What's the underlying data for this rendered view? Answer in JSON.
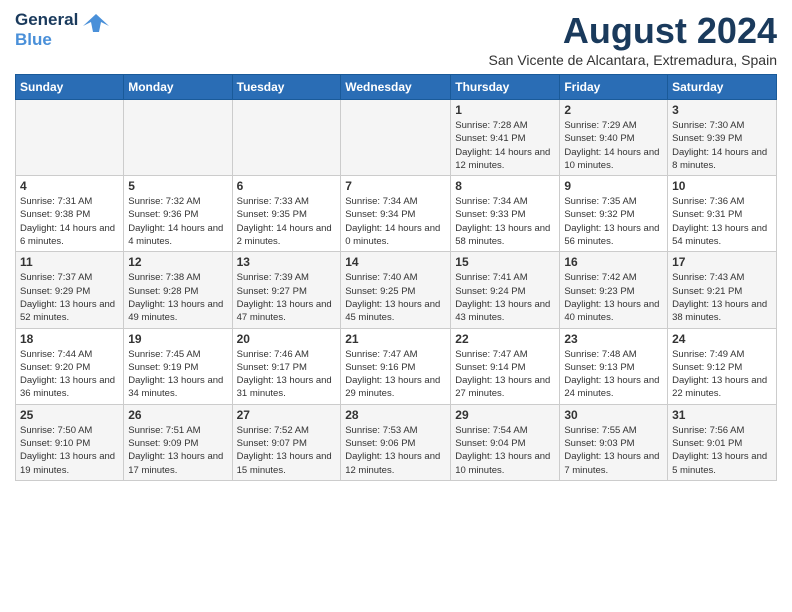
{
  "header": {
    "logo_line1": "General",
    "logo_line2": "Blue",
    "month_title": "August 2024",
    "subtitle": "San Vicente de Alcantara, Extremadura, Spain"
  },
  "days_of_week": [
    "Sunday",
    "Monday",
    "Tuesday",
    "Wednesday",
    "Thursday",
    "Friday",
    "Saturday"
  ],
  "weeks": [
    [
      {
        "day": "",
        "info": ""
      },
      {
        "day": "",
        "info": ""
      },
      {
        "day": "",
        "info": ""
      },
      {
        "day": "",
        "info": ""
      },
      {
        "day": "1",
        "info": "Sunrise: 7:28 AM\nSunset: 9:41 PM\nDaylight: 14 hours and 12 minutes."
      },
      {
        "day": "2",
        "info": "Sunrise: 7:29 AM\nSunset: 9:40 PM\nDaylight: 14 hours and 10 minutes."
      },
      {
        "day": "3",
        "info": "Sunrise: 7:30 AM\nSunset: 9:39 PM\nDaylight: 14 hours and 8 minutes."
      }
    ],
    [
      {
        "day": "4",
        "info": "Sunrise: 7:31 AM\nSunset: 9:38 PM\nDaylight: 14 hours and 6 minutes."
      },
      {
        "day": "5",
        "info": "Sunrise: 7:32 AM\nSunset: 9:36 PM\nDaylight: 14 hours and 4 minutes."
      },
      {
        "day": "6",
        "info": "Sunrise: 7:33 AM\nSunset: 9:35 PM\nDaylight: 14 hours and 2 minutes."
      },
      {
        "day": "7",
        "info": "Sunrise: 7:34 AM\nSunset: 9:34 PM\nDaylight: 14 hours and 0 minutes."
      },
      {
        "day": "8",
        "info": "Sunrise: 7:34 AM\nSunset: 9:33 PM\nDaylight: 13 hours and 58 minutes."
      },
      {
        "day": "9",
        "info": "Sunrise: 7:35 AM\nSunset: 9:32 PM\nDaylight: 13 hours and 56 minutes."
      },
      {
        "day": "10",
        "info": "Sunrise: 7:36 AM\nSunset: 9:31 PM\nDaylight: 13 hours and 54 minutes."
      }
    ],
    [
      {
        "day": "11",
        "info": "Sunrise: 7:37 AM\nSunset: 9:29 PM\nDaylight: 13 hours and 52 minutes."
      },
      {
        "day": "12",
        "info": "Sunrise: 7:38 AM\nSunset: 9:28 PM\nDaylight: 13 hours and 49 minutes."
      },
      {
        "day": "13",
        "info": "Sunrise: 7:39 AM\nSunset: 9:27 PM\nDaylight: 13 hours and 47 minutes."
      },
      {
        "day": "14",
        "info": "Sunrise: 7:40 AM\nSunset: 9:25 PM\nDaylight: 13 hours and 45 minutes."
      },
      {
        "day": "15",
        "info": "Sunrise: 7:41 AM\nSunset: 9:24 PM\nDaylight: 13 hours and 43 minutes."
      },
      {
        "day": "16",
        "info": "Sunrise: 7:42 AM\nSunset: 9:23 PM\nDaylight: 13 hours and 40 minutes."
      },
      {
        "day": "17",
        "info": "Sunrise: 7:43 AM\nSunset: 9:21 PM\nDaylight: 13 hours and 38 minutes."
      }
    ],
    [
      {
        "day": "18",
        "info": "Sunrise: 7:44 AM\nSunset: 9:20 PM\nDaylight: 13 hours and 36 minutes."
      },
      {
        "day": "19",
        "info": "Sunrise: 7:45 AM\nSunset: 9:19 PM\nDaylight: 13 hours and 34 minutes."
      },
      {
        "day": "20",
        "info": "Sunrise: 7:46 AM\nSunset: 9:17 PM\nDaylight: 13 hours and 31 minutes."
      },
      {
        "day": "21",
        "info": "Sunrise: 7:47 AM\nSunset: 9:16 PM\nDaylight: 13 hours and 29 minutes."
      },
      {
        "day": "22",
        "info": "Sunrise: 7:47 AM\nSunset: 9:14 PM\nDaylight: 13 hours and 27 minutes."
      },
      {
        "day": "23",
        "info": "Sunrise: 7:48 AM\nSunset: 9:13 PM\nDaylight: 13 hours and 24 minutes."
      },
      {
        "day": "24",
        "info": "Sunrise: 7:49 AM\nSunset: 9:12 PM\nDaylight: 13 hours and 22 minutes."
      }
    ],
    [
      {
        "day": "25",
        "info": "Sunrise: 7:50 AM\nSunset: 9:10 PM\nDaylight: 13 hours and 19 minutes."
      },
      {
        "day": "26",
        "info": "Sunrise: 7:51 AM\nSunset: 9:09 PM\nDaylight: 13 hours and 17 minutes."
      },
      {
        "day": "27",
        "info": "Sunrise: 7:52 AM\nSunset: 9:07 PM\nDaylight: 13 hours and 15 minutes."
      },
      {
        "day": "28",
        "info": "Sunrise: 7:53 AM\nSunset: 9:06 PM\nDaylight: 13 hours and 12 minutes."
      },
      {
        "day": "29",
        "info": "Sunrise: 7:54 AM\nSunset: 9:04 PM\nDaylight: 13 hours and 10 minutes."
      },
      {
        "day": "30",
        "info": "Sunrise: 7:55 AM\nSunset: 9:03 PM\nDaylight: 13 hours and 7 minutes."
      },
      {
        "day": "31",
        "info": "Sunrise: 7:56 AM\nSunset: 9:01 PM\nDaylight: 13 hours and 5 minutes."
      }
    ]
  ]
}
